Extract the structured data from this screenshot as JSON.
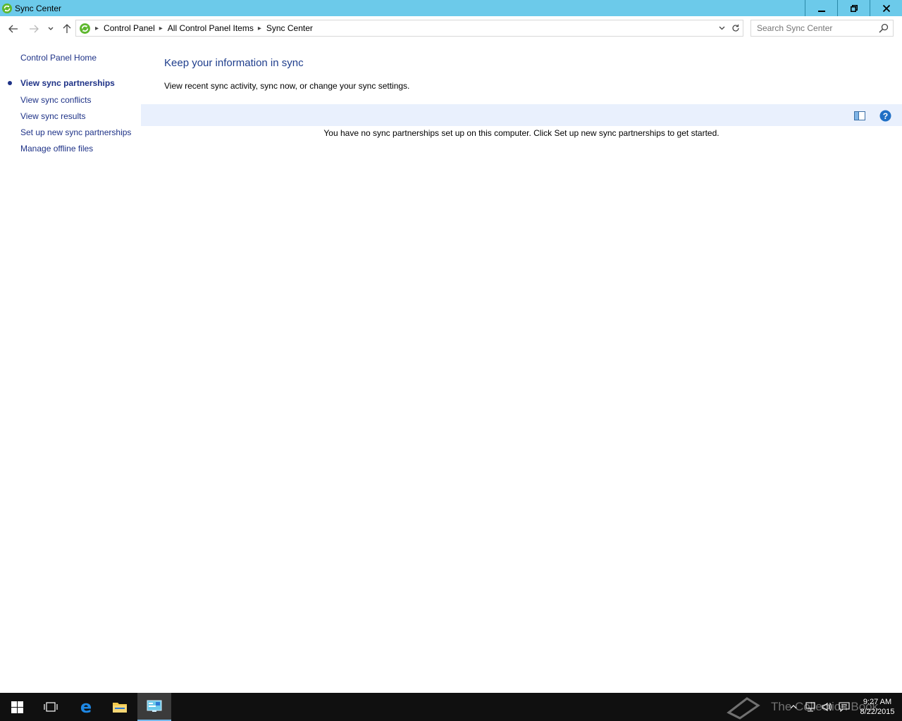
{
  "window": {
    "title": "Sync Center",
    "accent_color": "#6ccaea"
  },
  "icons": {
    "app": "sync-center-icon",
    "minimize": "minimize-icon",
    "restore": "restore-icon",
    "close": "close-icon",
    "back": "back-arrow-icon",
    "forward": "forward-arrow-icon",
    "recent": "chevron-down-icon",
    "up": "up-arrow-icon",
    "refresh": "refresh-icon",
    "search": "search-icon",
    "pane": "preview-pane-icon",
    "help": "help-icon"
  },
  "address_bar": {
    "breadcrumbs": [
      "Control Panel",
      "All Control Panel Items",
      "Sync Center"
    ]
  },
  "search": {
    "placeholder": "Search Sync Center"
  },
  "left_pane": {
    "home": "Control Panel Home",
    "links": [
      {
        "label": "View sync partnerships",
        "active": true
      },
      {
        "label": "View sync conflicts",
        "active": false
      },
      {
        "label": "View sync results",
        "active": false
      },
      {
        "label": "Set up new sync partnerships",
        "active": false
      },
      {
        "label": "Manage offline files",
        "active": false
      }
    ]
  },
  "main": {
    "heading": "Keep your information in sync",
    "subtext": "View recent sync activity, sync now, or change your sync settings.",
    "empty_message": "You have no sync partnerships set up on this computer. Click Set up new sync partnerships to get started."
  },
  "taskbar": {
    "watermark": "The Collection Book",
    "time": "9:27 AM",
    "date": "8/22/2015"
  }
}
